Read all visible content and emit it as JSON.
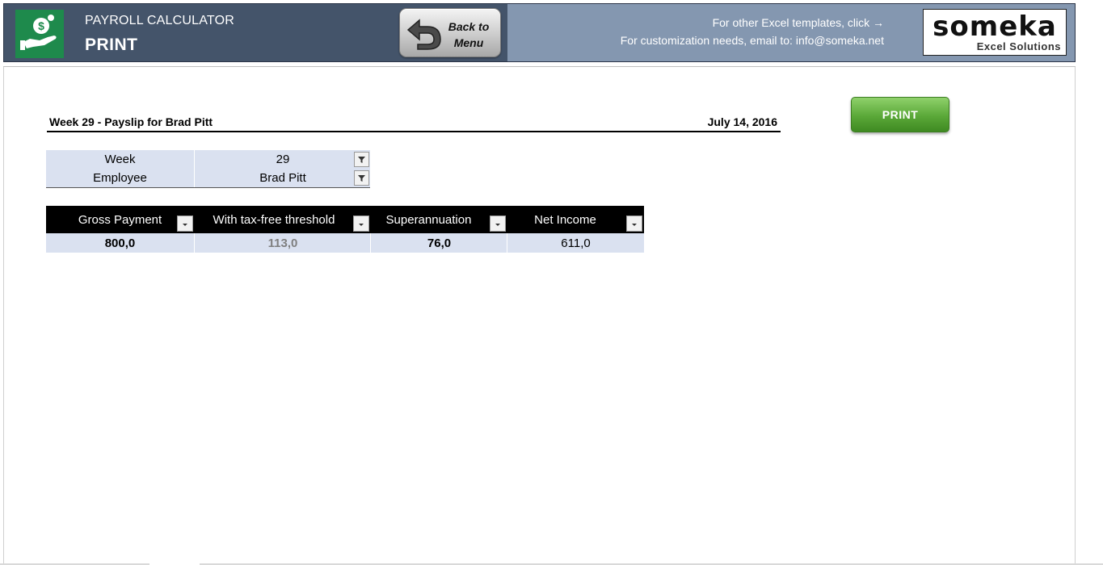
{
  "header": {
    "app_title": "PAYROLL CALCULATOR",
    "page_title": "PRINT",
    "back_button": {
      "line1": "Back to",
      "line2": "Menu"
    },
    "other_templates": "For other Excel templates, click →",
    "customization": "For customization needs, email to: info@someka.net",
    "logo": {
      "brand": "someka",
      "tagline": "Excel Solutions"
    },
    "colors": {
      "left_bg": "#44546a",
      "right_bg": "#8497b0",
      "icon_bg": "#1e8a4c"
    },
    "icons": {
      "app": "money-hand-icon",
      "back": "back-arrow-icon"
    }
  },
  "payslip": {
    "title": "Week 29 - Payslip for Brad Pitt",
    "date": "July 14, 2016"
  },
  "print_button": {
    "label": "PRINT",
    "color": "#5aa838"
  },
  "filters": {
    "rows": [
      {
        "label": "Week",
        "value": "29"
      },
      {
        "label": "Employee",
        "value": "Brad Pitt"
      }
    ]
  },
  "results": {
    "headers": [
      "Gross Payment",
      "With tax-free threshold",
      "Superannuation",
      "Net Income"
    ],
    "values": [
      "800,0",
      "113,0",
      "76,0",
      "611,0"
    ]
  }
}
